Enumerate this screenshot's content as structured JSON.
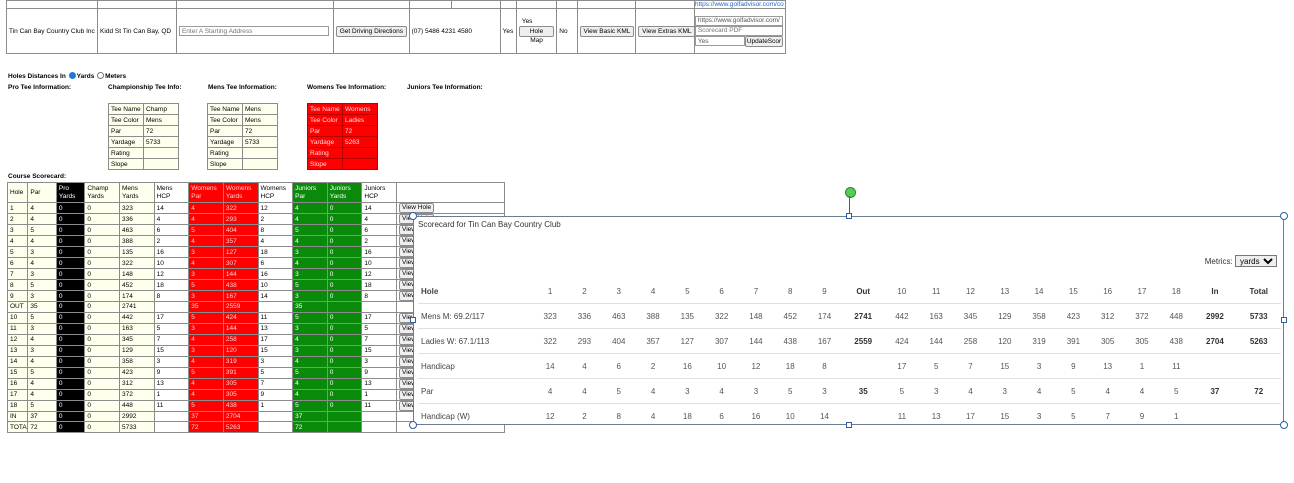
{
  "club": {
    "name": "Tin Can Bay Country Club Inc",
    "address": "Kidd St Tin Can Bay, QD",
    "start_placeholder": "Enter A Starting Address",
    "directions_btn": "Get Driving Directions",
    "phone": "(07) 5486 4231",
    "code": "4580",
    "yes1": "Yes",
    "yes2": "Yes",
    "hole_map_btn": "Hole Map",
    "no": "No",
    "basic_kml_btn": "View Basic KML",
    "extras_kml_btn": "View Extras KML",
    "link1": "https://www.golfadvisor.com/co",
    "link2_value": "https://www.golfadvisor.com/c",
    "scorecard_pdf_placeholder": "Scorecard PDF",
    "yes_input": "Yes",
    "update_btn": "UpdateScor"
  },
  "distances": {
    "label": "Holes Distances In",
    "yards": "Yards",
    "meters": "Meters",
    "selected": "Yards"
  },
  "tee_headers": {
    "pro": "Pro Tee Information:",
    "champ": "Championship Tee Info:",
    "mens": "Mens Tee Information:",
    "womens": "Womens Tee Information:",
    "juniors": "Juniors Tee Information:"
  },
  "tee_tables": {
    "champ": [
      [
        "Tee Name",
        "Champ"
      ],
      [
        "Tee Color",
        "Mens"
      ],
      [
        "Par",
        "72"
      ],
      [
        "Yardage",
        "5733"
      ],
      [
        "Rating",
        ""
      ],
      [
        "Slope",
        ""
      ]
    ],
    "mens": [
      [
        "Tee Name",
        "Mens"
      ],
      [
        "Tee Color",
        "Mens"
      ],
      [
        "Par",
        "72"
      ],
      [
        "Yardage",
        "5733"
      ],
      [
        "Rating",
        ""
      ],
      [
        "Slope",
        ""
      ]
    ],
    "womens": [
      [
        "Tee Name",
        "Womens"
      ],
      [
        "Tee Color",
        "Ladies"
      ],
      [
        "Par",
        "72"
      ],
      [
        "Yardage",
        "5263"
      ],
      [
        "Rating",
        ""
      ],
      [
        "Slope",
        ""
      ]
    ]
  },
  "course_scorecard": {
    "label": "Course Scorecard:",
    "headers": [
      "Hole",
      "Par",
      "Pro Yards",
      "Champ Yards",
      "Mens Yards",
      "Mens HCP",
      "Womens Par",
      "Womens Yards",
      "Womens HCP",
      "Juniors Par",
      "Juniors Yards",
      "Juniors HCP",
      ""
    ],
    "view_btn": "View Hole",
    "rows": [
      [
        "1",
        "4",
        "0",
        "0",
        "323",
        "14",
        "4",
        "322",
        "12",
        "4",
        "0",
        "14"
      ],
      [
        "2",
        "4",
        "0",
        "0",
        "336",
        "4",
        "4",
        "293",
        "2",
        "4",
        "0",
        "4"
      ],
      [
        "3",
        "5",
        "0",
        "0",
        "463",
        "6",
        "5",
        "404",
        "8",
        "5",
        "0",
        "6"
      ],
      [
        "4",
        "4",
        "0",
        "0",
        "388",
        "2",
        "4",
        "357",
        "4",
        "4",
        "0",
        "2"
      ],
      [
        "5",
        "3",
        "0",
        "0",
        "135",
        "16",
        "3",
        "127",
        "18",
        "3",
        "0",
        "16"
      ],
      [
        "6",
        "4",
        "0",
        "0",
        "322",
        "10",
        "4",
        "307",
        "6",
        "4",
        "0",
        "10"
      ],
      [
        "7",
        "3",
        "0",
        "0",
        "148",
        "12",
        "3",
        "144",
        "16",
        "3",
        "0",
        "12"
      ],
      [
        "8",
        "5",
        "0",
        "0",
        "452",
        "18",
        "5",
        "438",
        "10",
        "5",
        "0",
        "18"
      ],
      [
        "9",
        "3",
        "0",
        "0",
        "174",
        "8",
        "3",
        "167",
        "14",
        "3",
        "0",
        "8"
      ],
      [
        "OUT",
        "35",
        "0",
        "0",
        "2741",
        "",
        "35",
        "2559",
        "",
        "35",
        "",
        ""
      ],
      [
        "10",
        "5",
        "0",
        "0",
        "442",
        "17",
        "5",
        "424",
        "11",
        "5",
        "0",
        "17"
      ],
      [
        "11",
        "3",
        "0",
        "0",
        "163",
        "5",
        "3",
        "144",
        "13",
        "3",
        "0",
        "5"
      ],
      [
        "12",
        "4",
        "0",
        "0",
        "345",
        "7",
        "4",
        "258",
        "17",
        "4",
        "0",
        "7"
      ],
      [
        "13",
        "3",
        "0",
        "0",
        "129",
        "15",
        "3",
        "120",
        "15",
        "3",
        "0",
        "15"
      ],
      [
        "14",
        "4",
        "0",
        "0",
        "358",
        "3",
        "4",
        "319",
        "3",
        "4",
        "0",
        "3"
      ],
      [
        "15",
        "5",
        "0",
        "0",
        "423",
        "9",
        "5",
        "391",
        "5",
        "5",
        "0",
        "9"
      ],
      [
        "16",
        "4",
        "0",
        "0",
        "312",
        "13",
        "4",
        "305",
        "7",
        "4",
        "0",
        "13"
      ],
      [
        "17",
        "4",
        "0",
        "0",
        "372",
        "1",
        "4",
        "305",
        "9",
        "4",
        "0",
        "1"
      ],
      [
        "18",
        "5",
        "0",
        "0",
        "448",
        "11",
        "5",
        "438",
        "1",
        "5",
        "0",
        "11"
      ],
      [
        "IN",
        "37",
        "0",
        "0",
        "2992",
        "",
        "37",
        "2704",
        "",
        "37",
        "",
        ""
      ],
      [
        "TOTAL",
        "72",
        "0",
        "0",
        "5733",
        "",
        "72",
        "5263",
        "",
        "72",
        "",
        ""
      ]
    ]
  },
  "popup": {
    "title": "Scorecard for Tin Can Bay Country Club",
    "metrics_label": "Metrics:",
    "metrics_value": "yards",
    "header": [
      "Hole",
      "1",
      "2",
      "3",
      "4",
      "5",
      "6",
      "7",
      "8",
      "9",
      "Out",
      "10",
      "11",
      "12",
      "13",
      "14",
      "15",
      "16",
      "17",
      "18",
      "In",
      "Total"
    ],
    "rows": [
      [
        "Mens M: 69.2/117",
        "323",
        "336",
        "463",
        "388",
        "135",
        "322",
        "148",
        "452",
        "174",
        "2741",
        "442",
        "163",
        "345",
        "129",
        "358",
        "423",
        "312",
        "372",
        "448",
        "2992",
        "5733"
      ],
      [
        "Ladies W: 67.1/113",
        "322",
        "293",
        "404",
        "357",
        "127",
        "307",
        "144",
        "438",
        "167",
        "2559",
        "424",
        "144",
        "258",
        "120",
        "319",
        "391",
        "305",
        "305",
        "438",
        "2704",
        "5263"
      ],
      [
        "Handicap",
        "14",
        "4",
        "6",
        "2",
        "16",
        "10",
        "12",
        "18",
        "8",
        "",
        "17",
        "5",
        "7",
        "15",
        "3",
        "9",
        "13",
        "1",
        "11",
        "",
        ""
      ],
      [
        "Par",
        "4",
        "4",
        "5",
        "4",
        "3",
        "4",
        "3",
        "5",
        "3",
        "35",
        "5",
        "3",
        "4",
        "3",
        "4",
        "5",
        "4",
        "4",
        "5",
        "37",
        "72"
      ],
      [
        "Handicap (W)",
        "12",
        "2",
        "8",
        "4",
        "18",
        "6",
        "16",
        "10",
        "14",
        "",
        "11",
        "13",
        "17",
        "15",
        "3",
        "5",
        "7",
        "9",
        "1",
        "",
        ""
      ]
    ]
  }
}
